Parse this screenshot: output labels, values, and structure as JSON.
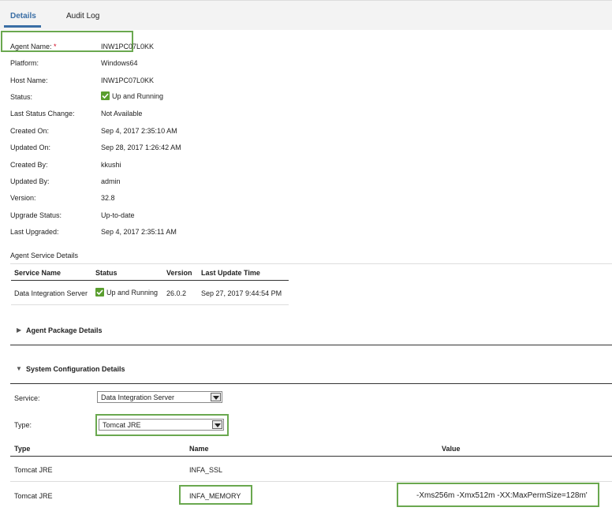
{
  "tabs": [
    {
      "label": "Details",
      "active": true
    },
    {
      "label": "Audit Log",
      "active": false
    }
  ],
  "details": [
    {
      "label": "Agent Name:",
      "value": "INW1PC07L0KK",
      "required": "*"
    },
    {
      "label": "Platform:",
      "value": "Windows64"
    },
    {
      "label": "Host Name:",
      "value": "INW1PC07L0KK"
    },
    {
      "label": "Status:",
      "value": "Up and Running"
    },
    {
      "label": "Last Status Change:",
      "value": "Not Available"
    },
    {
      "label": "Created On:",
      "value": "Sep 4, 2017 2:35:10 AM"
    },
    {
      "label": "Updated On:",
      "value": "Sep 28, 2017 1:26:42 AM"
    },
    {
      "label": "Created By:",
      "value": "kkushi"
    },
    {
      "label": "Updated By:",
      "value": "admin"
    },
    {
      "label": "Version:",
      "value": "32.8"
    },
    {
      "label": "Upgrade Status:",
      "value": "Up-to-date"
    },
    {
      "label": "Last Upgraded:",
      "value": "Sep 4, 2017 2:35:11 AM"
    }
  ],
  "agent_service": {
    "title": "Agent Service Details",
    "headers": [
      "Service Name",
      "Status",
      "Version",
      "Last Update Time"
    ],
    "rows": [
      {
        "service": "Data Integration Server",
        "status": "Up and Running",
        "version": "26.0.2",
        "updated": "Sep 27, 2017 9:44:54 PM"
      }
    ]
  },
  "package_section": {
    "title": "Agent Package Details"
  },
  "sysconfig": {
    "title": "System Configuration Details",
    "service_label": "Service:",
    "service_value": "Data Integration Server",
    "type_label": "Type:",
    "type_value": "Tomcat JRE",
    "headers": [
      "Type",
      "Name",
      "Value"
    ],
    "rows": [
      {
        "type": "Tomcat JRE",
        "name": "INFA_SSL",
        "value": ""
      },
      {
        "type": "Tomcat JRE",
        "name": "INFA_MEMORY",
        "value": "-Xms256m -Xmx512m -XX:MaxPermSize=128m'"
      }
    ]
  },
  "colors": {
    "accent": "#3a6ea5",
    "highlight": "#6aa84f",
    "status_green": "#5a9e2f",
    "required": "#d0021b"
  }
}
